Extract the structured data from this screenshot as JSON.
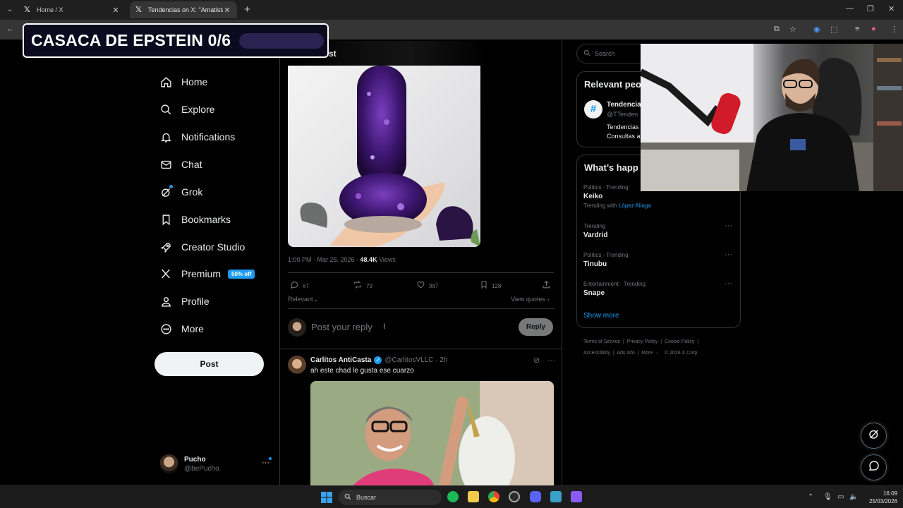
{
  "browser": {
    "tabs": [
      {
        "label": "Home / X",
        "active": false
      },
      {
        "label": "Tendencias on X: \"Amatista\": P",
        "active": true
      }
    ],
    "new_tab": "+"
  },
  "overlay": {
    "banner_text": "CASACA DE EPSTEIN 0/6"
  },
  "nav": {
    "items": [
      {
        "label": "Home",
        "icon": "home-icon"
      },
      {
        "label": "Explore",
        "icon": "search-icon"
      },
      {
        "label": "Notifications",
        "icon": "bell-icon"
      },
      {
        "label": "Chat",
        "icon": "mail-icon"
      },
      {
        "label": "Grok",
        "icon": "grok-icon"
      },
      {
        "label": "Bookmarks",
        "icon": "bookmark-icon"
      },
      {
        "label": "Creator Studio",
        "icon": "rocket-icon"
      },
      {
        "label": "Premium",
        "icon": "x-logo-icon",
        "badge": "50% off"
      },
      {
        "label": "Profile",
        "icon": "person-icon"
      },
      {
        "label": "More",
        "icon": "more-circle-icon"
      }
    ],
    "post_button": "Post",
    "account": {
      "name": "Pucho",
      "handle": "@bePucho"
    }
  },
  "post": {
    "header_title": "st",
    "meta_time": "1:00 PM · Mar 25, 2026 · ",
    "meta_views_count": "48.4K",
    "meta_views_label": " Views",
    "actions": {
      "replies": "67",
      "reposts": "79",
      "likes": "987",
      "bookmarks": "128"
    },
    "sort_label": "Relevant",
    "view_quotes": "View quotes",
    "reply_placeholder": "Post your reply",
    "reply_button": "Reply"
  },
  "comment": {
    "name": "Carlitos AntiCasta",
    "handle": "@CarlitosVLLC · 2h",
    "text": "ah este chad le gusta ese cuarzo"
  },
  "sidebar": {
    "search_placeholder": "Search",
    "relevant_title": "Relevant peo",
    "relevant_person": {
      "name": "Tendencias",
      "handle": "@TTenden",
      "bio1": "Tendencias",
      "bio2": "Consultas a"
    },
    "happening_title": "What’s happ",
    "trends": [
      {
        "context": "Politics · Trending",
        "name": "Keiko",
        "with_prefix": "Trending with ",
        "with_link": "López Aliaga"
      },
      {
        "context": "Trending",
        "name": "Vardrid"
      },
      {
        "context": "Politics · Trending",
        "name": "Tinubu"
      },
      {
        "context": "Entertainment · Trending",
        "name": "Snape"
      }
    ],
    "show_more": "Show more",
    "footer": [
      "Terms of Service",
      "Privacy Policy",
      "Cookie Policy",
      "Accessibility",
      "Ads info",
      "More ···",
      "© 2026 X Corp."
    ]
  },
  "taskbar": {
    "search_label": "Buscar",
    "time": "16:09",
    "date": "25/03/2026"
  },
  "colors": {
    "accent": "#1d9bf0",
    "background": "#000000",
    "border": "#2f3336",
    "muted_text": "#71767b"
  }
}
